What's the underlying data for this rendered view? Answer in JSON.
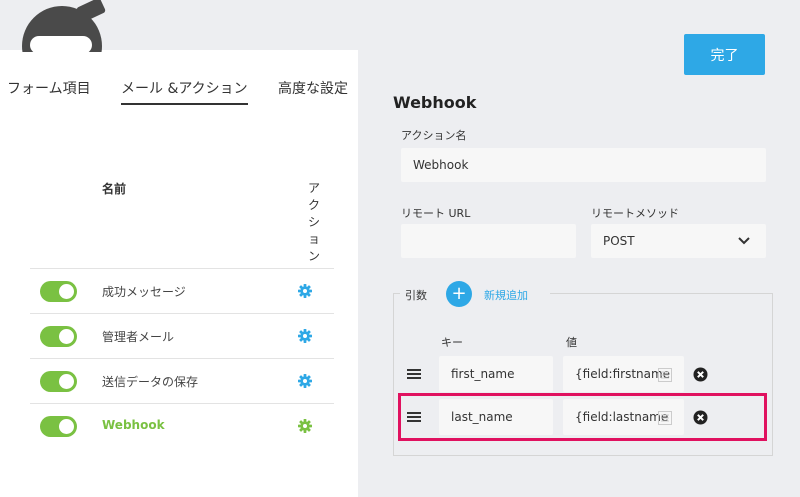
{
  "header": {
    "done_label": "完了"
  },
  "tabs": [
    {
      "label": "フォーム項目"
    },
    {
      "label": "メール &アクション"
    },
    {
      "label": "高度な設定"
    }
  ],
  "actions_table": {
    "col_name": "名前",
    "col_action": "アクション",
    "rows": [
      {
        "label": "成功メッセージ",
        "enabled": true
      },
      {
        "label": "管理者メール",
        "enabled": true
      },
      {
        "label": "送信データの保存",
        "enabled": true
      },
      {
        "label": "Webhook",
        "enabled": true,
        "active": true
      }
    ]
  },
  "webhook": {
    "title": "Webhook",
    "action_name_label": "アクション名",
    "action_name_value": "Webhook",
    "remote_url_label": "リモート URL",
    "remote_url_value": "",
    "remote_method_label": "リモートメソッド",
    "remote_method_value": "POST",
    "args": {
      "label": "引数",
      "add_label": "新規追加",
      "key_header": "キー",
      "value_header": "値",
      "rows": [
        {
          "key": "first_name",
          "value": "{field:firstname"
        },
        {
          "key": "last_name",
          "value": "{field:lastname"
        }
      ]
    }
  },
  "colors": {
    "accent": "#2ea8e6",
    "toggle_on": "#7ac142",
    "highlight": "#e0115f"
  },
  "icons": [
    "ninja-logo-icon",
    "gear-icon",
    "plus-icon",
    "chevron-down-icon",
    "drag-handle-icon",
    "list-icon",
    "remove-icon"
  ]
}
